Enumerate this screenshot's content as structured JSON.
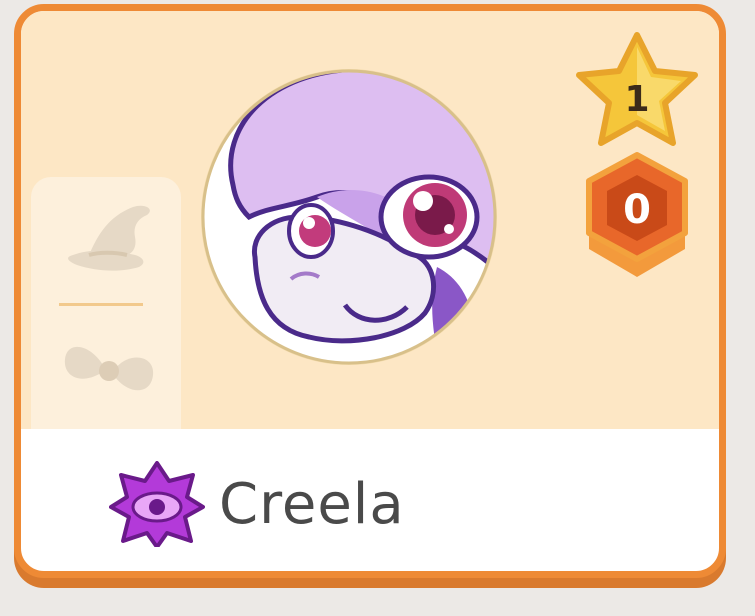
{
  "player": {
    "name": "Creela",
    "stars": "1",
    "hex_count": "0",
    "rank_icon": "purple-star-eye-icon"
  },
  "slots": {
    "hat_icon": "wizard-hat-icon",
    "accessory_icon": "bow-icon"
  },
  "colors": {
    "card_border": "#ee8a35",
    "card_background": "#fde7c5",
    "avatar_purple": "#dcbcef",
    "star_gold": "#f5c63a",
    "hex_orange": "#e8672a",
    "rank_purple": "#b33ad9"
  }
}
